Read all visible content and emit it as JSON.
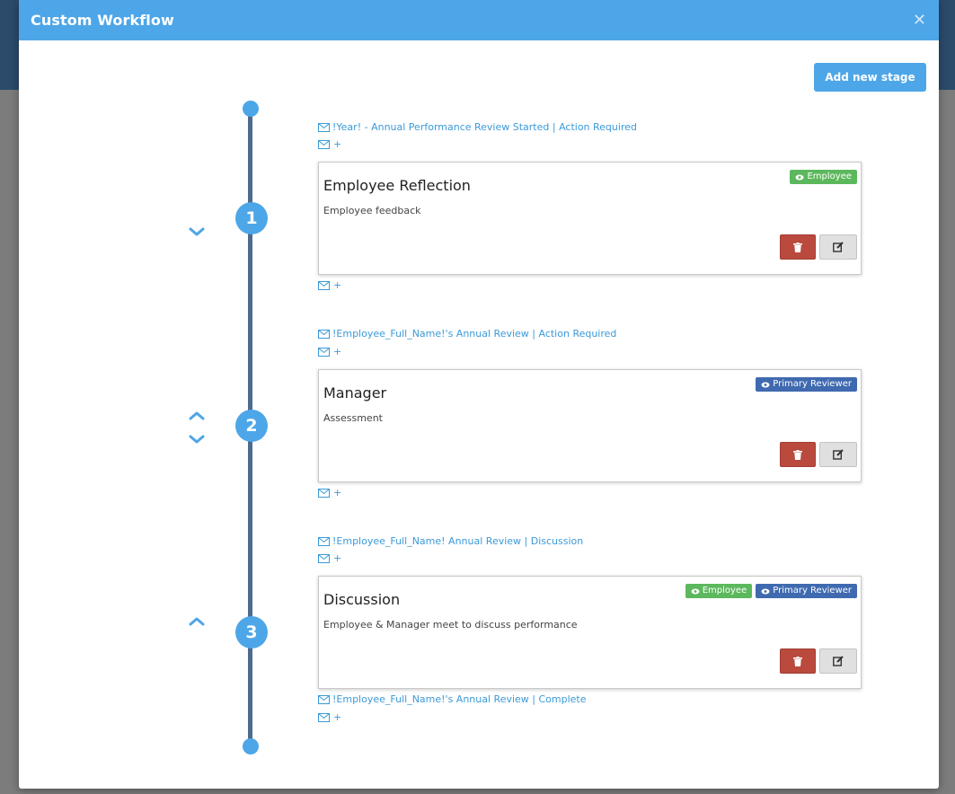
{
  "modal": {
    "title": "Custom Workflow",
    "close_icon": "close-icon"
  },
  "toolbar": {
    "add_stage_label": "Add new stage"
  },
  "stages": [
    {
      "number": "1",
      "email_before": "!Year! - Annual Performance Review Started | Action Required",
      "plus": "+",
      "title": "Employee Reflection",
      "description": "Employee feedback",
      "badges": [
        "Employee"
      ],
      "plus_after": "+"
    },
    {
      "number": "2",
      "email_before": "!Employee_Full_Name!'s Annual Review | Action Required",
      "plus": "+",
      "title": "Manager",
      "description": "Assessment",
      "badges": [
        "Primary Reviewer"
      ],
      "plus_after": "+"
    },
    {
      "number": "3",
      "email_before": "!Employee_Full_Name! Annual Review | Discussion",
      "plus": "+",
      "title": "Discussion",
      "description": "Employee & Manager meet to discuss performance",
      "badges": [
        "Employee",
        "Primary Reviewer"
      ],
      "email_after": "!Employee_Full_Name!'s Annual Review | Complete",
      "plus_after": "+"
    }
  ],
  "colors": {
    "header": "#4da6e8",
    "timeline": "#4e6a8d",
    "badge_employee": "#5cb85c",
    "badge_reviewer": "#3f6ab0",
    "delete": "#b94a3d"
  }
}
